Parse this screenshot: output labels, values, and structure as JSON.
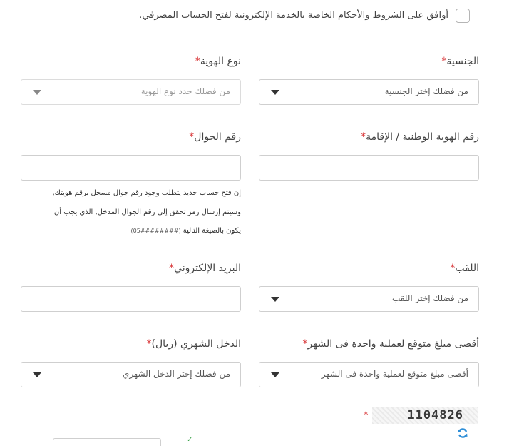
{
  "terms": {
    "text": "أوافق على الشروط والأحكام الخاصة بالخدمة الإلكترونية لفتح الحساب المصرفي."
  },
  "form": {
    "required_mark": "*",
    "nationality": {
      "label": "الجنسية",
      "value": "من فضلك إختر الجنسية"
    },
    "id_type": {
      "label": "نوع الهوية",
      "value": "من فضلك حدد نوع الهوية"
    },
    "national_id": {
      "label": "رقم الهوية الوطنية / الإقامة",
      "value": ""
    },
    "mobile": {
      "label": "رقم الجوال",
      "value": "",
      "note_line1": "إن فتح حساب جديد يتطلب وجود رقم جوال مسجل برقم هويتك,",
      "note_line2": "وسيتم إرسال رمز تحقق إلى رقم الجوال المدخل, الذي يجب أن",
      "note_line3": "يكون بالصيغة التالية",
      "note_format": "(05########)"
    },
    "title": {
      "label": "اللقب",
      "value": "من فضلك إختر اللقب"
    },
    "email": {
      "label": "البريد الإلكتروني",
      "value": ""
    },
    "max_amount": {
      "label": "أقصى مبلغ متوقع لعملية واحدة فى الشهر",
      "value": "أقصى مبلغ متوقع لعملية واحدة فى الشهر"
    },
    "monthly_income": {
      "label": "الدخل الشهري (ريال)",
      "value": "من فضلك إختر الدخل الشهري"
    }
  },
  "captcha": {
    "text": "1104826"
  },
  "colors": {
    "required": "#d9383a",
    "border": "#cfcfcf",
    "refresh": "#2f8fd8"
  }
}
